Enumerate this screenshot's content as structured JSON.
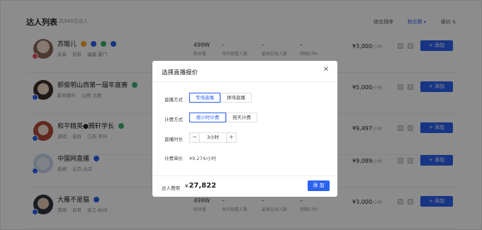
{
  "header": {
    "title": "达人列表",
    "count": "共945位达人",
    "sorts": [
      "综合排序",
      "粉丝数",
      "报价"
    ]
  },
  "rows": [
    {
      "name": "苏璇儿",
      "tags": [
        "女装",
        "自有",
        "福建-厦门"
      ],
      "followers": "499W",
      "followers_label": "粉丝量",
      "stat2": "–",
      "stat2_label": "场均观看人数",
      "stat3": "–",
      "stat3_label": "最高在线人数",
      "stat4": "–",
      "stat4_label": "预期CPM",
      "price": "¥3,000",
      "price_unit": "/小时",
      "add": "+ 添加"
    },
    {
      "name": "郝俊明山西第一届年度赛",
      "tags": [
        "影视娱乐",
        "山西-太原"
      ],
      "followers": "",
      "followers_label": "",
      "stat2": "",
      "stat2_label": "",
      "stat3": "",
      "stat3_label": "",
      "stat4": "",
      "stat4_label": "",
      "price": "¥5,000",
      "price_unit": "/小时",
      "add": "+ 添加"
    },
    {
      "name": "和平精英●腾轩学长",
      "tags": [
        "游戏",
        "自有",
        "江苏-常州"
      ],
      "followers": "",
      "followers_label": "",
      "stat2": "",
      "stat2_label": "",
      "stat3": "",
      "stat3_label": "",
      "stat4": "",
      "stat4_label": "",
      "price": "¥9,497",
      "price_unit": "/小时",
      "add": "+ 添加"
    },
    {
      "name": "中国网直播",
      "tags": [
        "新闻",
        "北京-北京"
      ],
      "followers": "",
      "followers_label": "",
      "stat2": "",
      "stat2_label": "",
      "stat3": "",
      "stat3_label": "",
      "stat4": "",
      "stat4_label": "",
      "price": "¥9,089",
      "price_unit": "/小时",
      "add": "+ 添加"
    },
    {
      "name": "大雁不是猫",
      "tags": [
        "游戏",
        "自有",
        "浙江-杭州"
      ],
      "followers": "499W",
      "followers_label": "粉丝量",
      "stat2": "–",
      "stat2_label": "场均观看人数",
      "stat3": "–",
      "stat3_label": "最高在线人数",
      "stat4": "–",
      "stat4_label": "预期CPM",
      "price": "¥3,000",
      "price_unit": "/小时",
      "add": "+ 添加"
    }
  ],
  "modal": {
    "title": "选择直播报价",
    "close": "✕",
    "live_mode_label": "直播方式",
    "live_mode_options": [
      "专场直播",
      "拼场直播"
    ],
    "billing_label": "计费方式",
    "billing_options": [
      "按小时计费",
      "按天计费"
    ],
    "duration_label": "直播时长",
    "duration_minus": "−",
    "duration_value": "3小时",
    "duration_plus": "+",
    "unit_price_label": "计费单价",
    "unit_price_value": "¥9,274/小时",
    "fee_label": "达人费用",
    "fee_currency": "¥",
    "fee_value": "27,822",
    "add_button": "添 加"
  },
  "colors": {
    "accent": "#2b62f1"
  }
}
